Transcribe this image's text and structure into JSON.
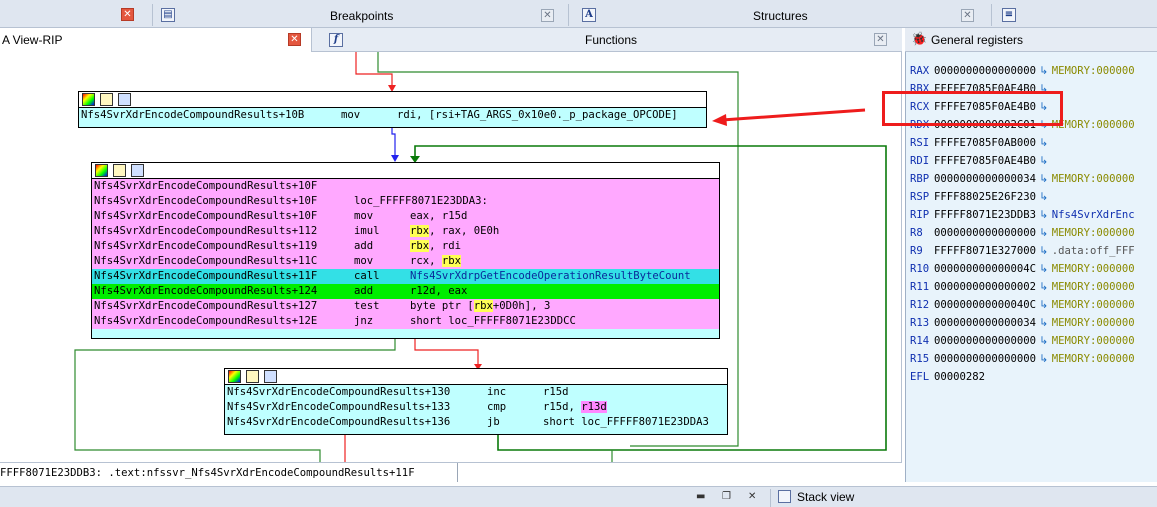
{
  "tabs": {
    "breakpoints": "Breakpoints",
    "structures": "Structures",
    "ida_view": "A View-RIP",
    "functions": "Functions",
    "general_registers": "General registers",
    "stack_view": "Stack view"
  },
  "graph": {
    "block1": {
      "lines": [
        {
          "addr": "Nfs4SvrXdrEncodeCompoundResults+10B",
          "mn": "mov",
          "op": "rdi, [rsi+TAG_ARGS_0x10e0._p_package_OPCODE]"
        }
      ]
    },
    "block2": {
      "lines": [
        {
          "addr": "Nfs4SvrXdrEncodeCompoundResults+10F",
          "mn": "",
          "op": ""
        },
        {
          "addr": "Nfs4SvrXdrEncodeCompoundResults+10F",
          "mn": "loc_FFFFF8071E23DDA3:",
          "op": ""
        },
        {
          "addr": "Nfs4SvrXdrEncodeCompoundResults+10F",
          "mn": "mov",
          "op": "eax, r15d"
        },
        {
          "addr": "Nfs4SvrXdrEncodeCompoundResults+112",
          "mn": "imul",
          "op": "rbx, rax, 0E0h"
        },
        {
          "addr": "Nfs4SvrXdrEncodeCompoundResults+119",
          "mn": "add",
          "op": "rbx, rdi"
        },
        {
          "addr": "Nfs4SvrXdrEncodeCompoundResults+11C",
          "mn": "mov",
          "op": "rcx, rbx"
        },
        {
          "addr": "Nfs4SvrXdrEncodeCompoundResults+11F",
          "mn": "call",
          "op": "Nfs4SvrXdrpGetEncodeOperationResultByteCount"
        },
        {
          "addr": "Nfs4SvrXdrEncodeCompoundResults+124",
          "mn": "add",
          "op": "r12d, eax"
        },
        {
          "addr": "Nfs4SvrXdrEncodeCompoundResults+127",
          "mn": "test",
          "op": "byte ptr [rbx+0D0h], 3"
        },
        {
          "addr": "Nfs4SvrXdrEncodeCompoundResults+12E",
          "mn": "jnz",
          "op": "short loc_FFFFF8071E23DDCC"
        }
      ]
    },
    "block3": {
      "lines": [
        {
          "addr": "Nfs4SvrXdrEncodeCompoundResults+130",
          "mn": "inc",
          "op": "r15d"
        },
        {
          "addr": "Nfs4SvrXdrEncodeCompoundResults+133",
          "mn": "cmp",
          "op": "r15d, r13d"
        },
        {
          "addr": "Nfs4SvrXdrEncodeCompoundResults+136",
          "mn": "jb",
          "op": "short loc_FFFFF8071E23DDA3"
        }
      ]
    }
  },
  "status_line": "FFFF8071E23DDB3: .text:nfssvr_Nfs4SvrXdrEncodeCompoundResults+11F",
  "registers": [
    {
      "name": "RAX",
      "value": "0000000000000000",
      "extra": "MEMORY:000000"
    },
    {
      "name": "RBX",
      "value": "FFFFE7085F0AE4B0",
      "extra": ""
    },
    {
      "name": "RCX",
      "value": "FFFFE7085F0AE4B0",
      "extra": ""
    },
    {
      "name": "RDX",
      "value": "0000000000002C01",
      "extra": "MEMORY:000000"
    },
    {
      "name": "RSI",
      "value": "FFFFE7085F0AB000",
      "extra": ""
    },
    {
      "name": "RDI",
      "value": "FFFFE7085F0AE4B0",
      "extra": ""
    },
    {
      "name": "RBP",
      "value": "0000000000000034",
      "extra": "MEMORY:000000"
    },
    {
      "name": "RSP",
      "value": "FFFF88025E26F230",
      "extra": ""
    },
    {
      "name": "RIP",
      "value": "FFFFF8071E23DDB3",
      "extra": "Nfs4SvrXdrEnc"
    },
    {
      "name": "R8",
      "value": "0000000000000000",
      "extra": "MEMORY:000000"
    },
    {
      "name": "R9",
      "value": "FFFFF8071E327000",
      "extra": ".data:off_FFF"
    },
    {
      "name": "R10",
      "value": "000000000000004C",
      "extra": "MEMORY:000000"
    },
    {
      "name": "R11",
      "value": "0000000000000002",
      "extra": "MEMORY:000000"
    },
    {
      "name": "R12",
      "value": "000000000000040C",
      "extra": "MEMORY:000000"
    },
    {
      "name": "R13",
      "value": "0000000000000034",
      "extra": "MEMORY:000000"
    },
    {
      "name": "R14",
      "value": "0000000000000000",
      "extra": "MEMORY:000000"
    },
    {
      "name": "R15",
      "value": "0000000000000000",
      "extra": "MEMORY:000000"
    },
    {
      "name": "EFL",
      "value": "00000282",
      "extra": ""
    }
  ],
  "colors": {
    "node_bg": "#bfffff",
    "pink": "#ffa8ff",
    "call_line": "#33e0e6",
    "exec_line": "#00ee00",
    "highlight": "#ffff55",
    "annotation": "#ee1c1c"
  },
  "icons": {
    "close": "close-icon",
    "breakpoints": "breakpoints-icon",
    "structures": "structures-icon",
    "functions": "functions-icon",
    "registers": "bug-icon",
    "stack": "stack-icon"
  }
}
